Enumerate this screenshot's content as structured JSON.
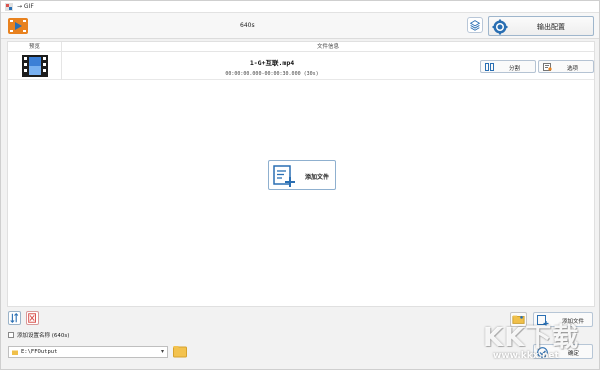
{
  "window": {
    "title": "→ GIF"
  },
  "toolbar": {
    "preset_label": "640s",
    "output_config_label": "输出配置",
    "left_icon": "video-converter-icon",
    "layers_icon": "layers-icon",
    "gear_icon": "gear-icon"
  },
  "table": {
    "columns": [
      "预览",
      "文件信息"
    ],
    "rows": [
      {
        "file_name": "1-G+互联.mp4",
        "time_range": "00:00:00.000-00:00:30.000 (30s)",
        "thumb_icon": "video-film-icon"
      }
    ]
  },
  "row_actions": {
    "split_label": "分割",
    "options_label": "选项"
  },
  "center_add_label": "添加文件",
  "bottom": {
    "checkbox_label": "添加设置名称 (640s)",
    "checkbox_checked": false,
    "output_path": "E:\\FFOutput",
    "add_file_label": "添加文件",
    "ok_label": "确定"
  },
  "watermark": {
    "logo": "KK下载",
    "url": "www.kkx.net"
  },
  "colors": {
    "accent_blue": "#2a6fb3",
    "orange": "#e8821f",
    "red_icon": "#d9534f"
  }
}
